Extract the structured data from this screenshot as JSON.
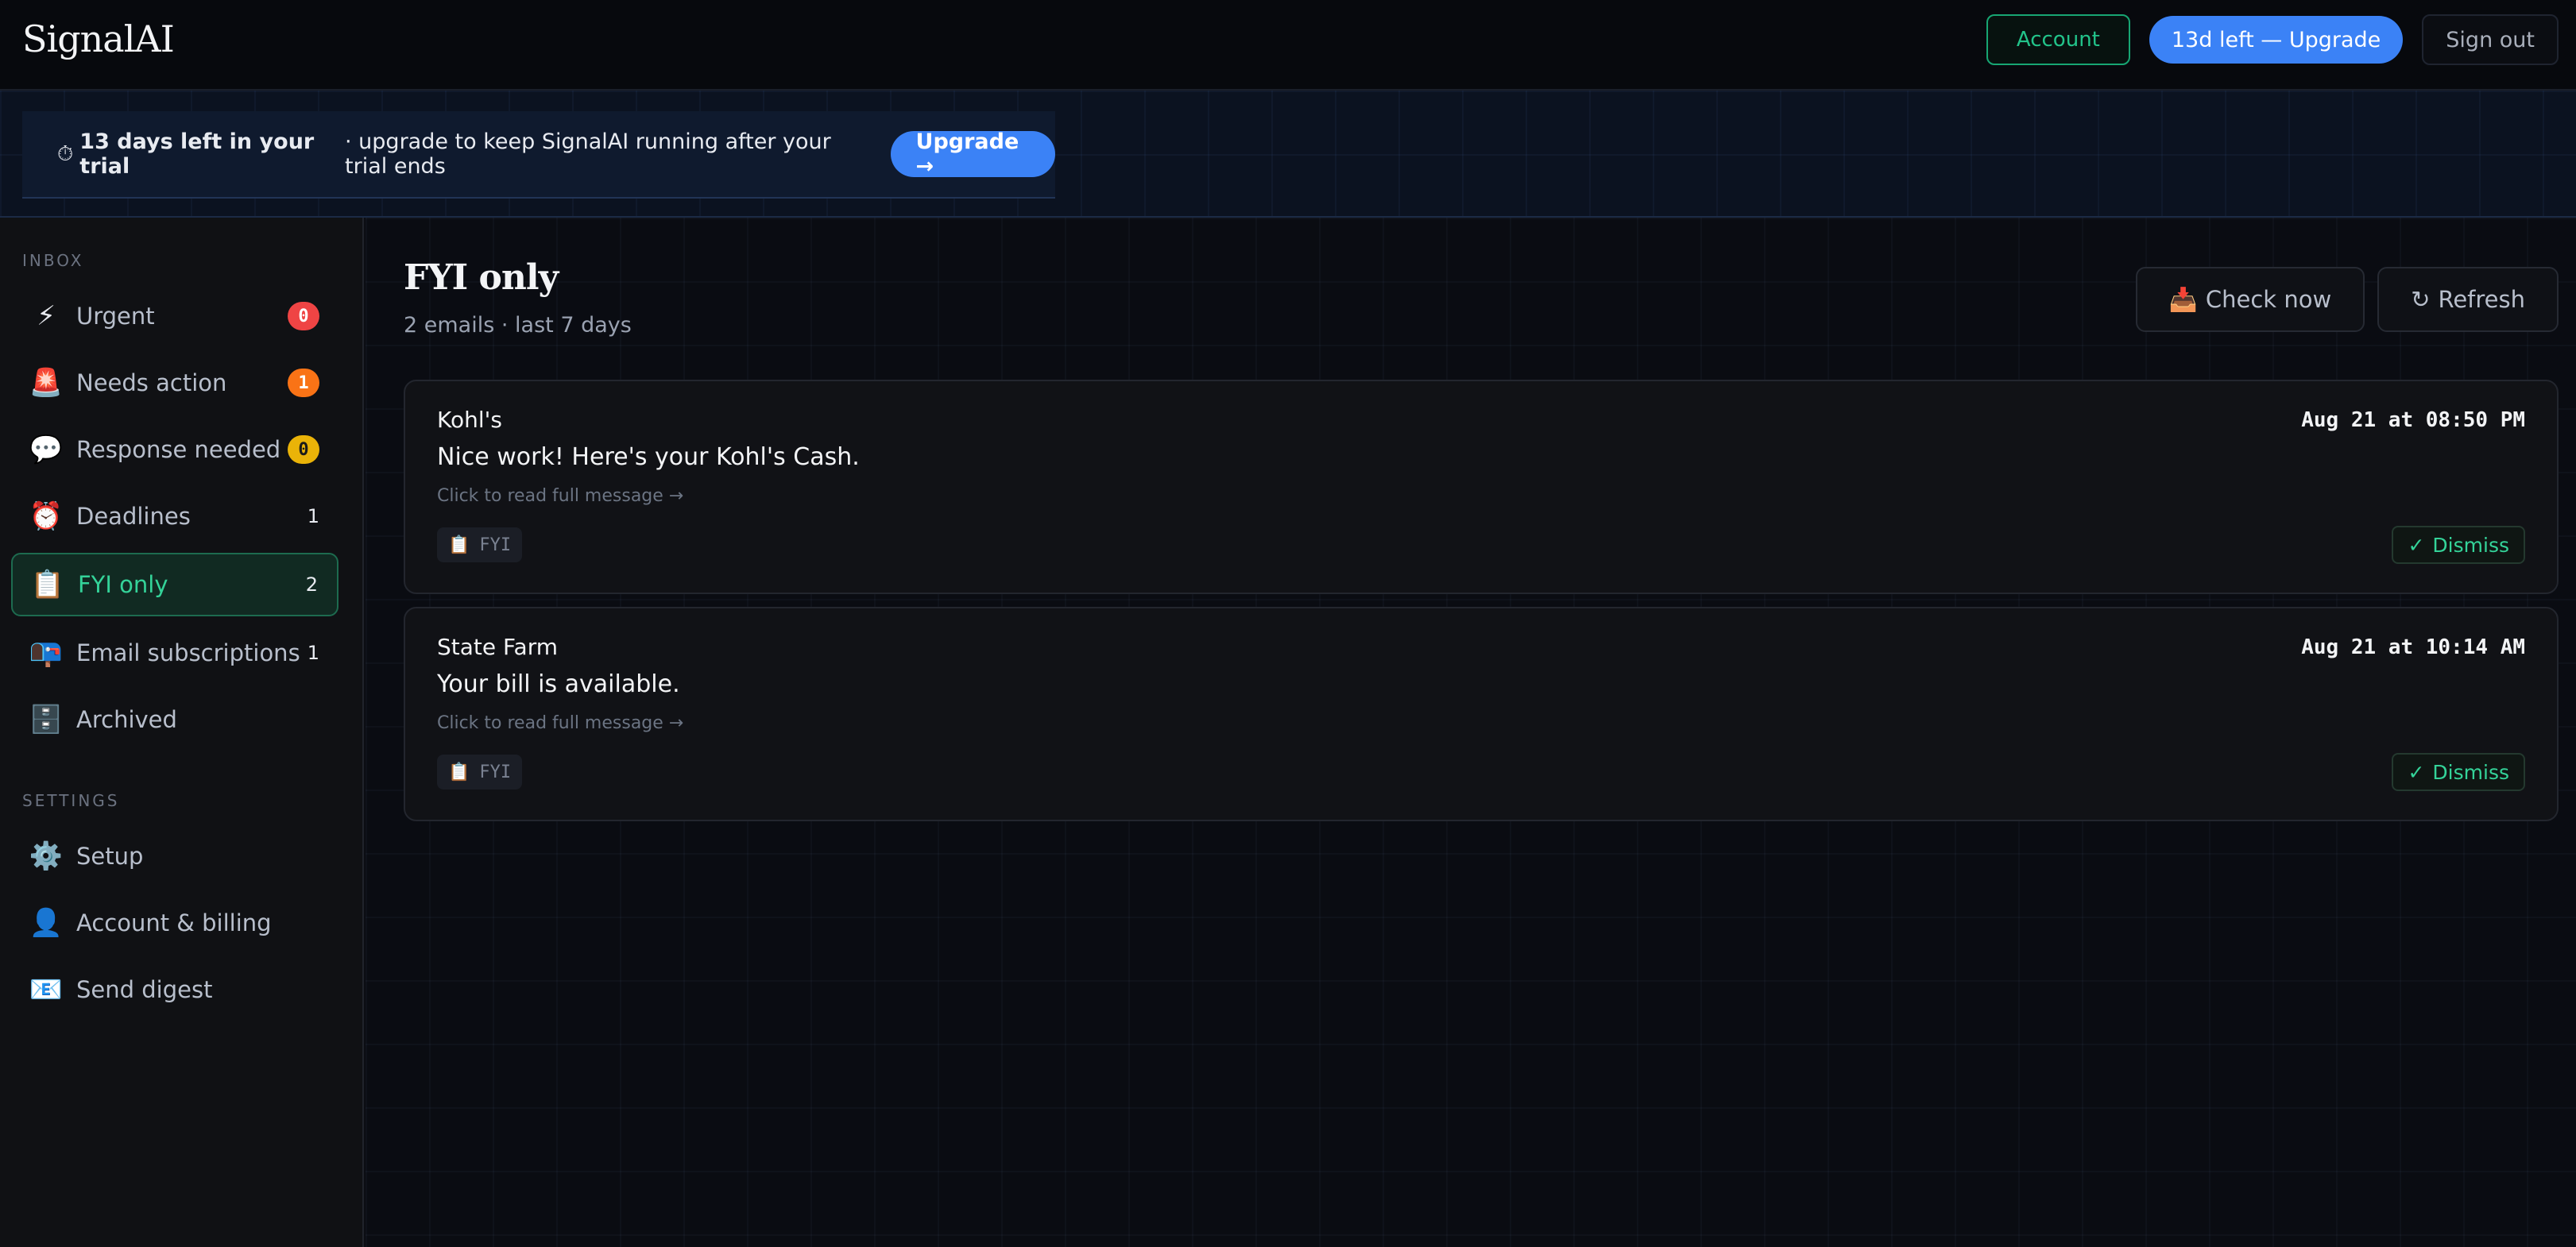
{
  "app": {
    "title": "SignalAI"
  },
  "topbar": {
    "account_label": "Account",
    "upgrade_label": "13d left — Upgrade",
    "signout_label": "Sign out"
  },
  "banner": {
    "icon": "⏱",
    "bold_text": "13 days left in your trial",
    "text": "· upgrade to keep SignalAI running after your trial ends",
    "button_label": "Upgrade →"
  },
  "sidebar": {
    "inbox_label": "INBOX",
    "settings_label": "SETTINGS",
    "inbox_items": [
      {
        "icon": "⚡",
        "label": "Urgent",
        "count": "0"
      },
      {
        "icon": "🚨",
        "label": "Needs action",
        "count": "1"
      },
      {
        "icon": "💬",
        "label": "Response needed",
        "count": "0"
      },
      {
        "icon": "⏰",
        "label": "Deadlines",
        "count": "1"
      },
      {
        "icon": "📋",
        "label": "FYI only",
        "count": "2"
      },
      {
        "icon": "📭",
        "label": "Email subscriptions",
        "count": "1"
      },
      {
        "icon": "🗄️",
        "label": "Archived"
      }
    ],
    "settings_items": [
      {
        "icon": "⚙️",
        "label": "Setup"
      },
      {
        "icon": "👤",
        "label": "Account & billing"
      },
      {
        "icon": "📧",
        "label": "Send digest"
      }
    ],
    "badge_colors": {
      "urgent": "#ef4444",
      "needs_action": "#f97316",
      "response_needed": "#eab308"
    }
  },
  "main": {
    "title": "FYI only",
    "subtitle": "2 emails · last 7 days",
    "check_now_icon": "📥",
    "check_now_label": "Check now",
    "refresh_icon": "↻",
    "refresh_label": "Refresh",
    "emails": [
      {
        "from": "Kohl's",
        "subject": "Nice work! Here's your Kohl's Cash.",
        "hint": "Click to read full message →",
        "date": "Aug 21 at 08:50 PM",
        "tag_icon": "📋",
        "tag": "FYI",
        "dismiss_icon": "✓",
        "dismiss_label": "Dismiss"
      },
      {
        "from": "State Farm",
        "subject": "Your bill is available.",
        "hint": "Click to read full message →",
        "date": "Aug 21 at 10:14 AM",
        "tag_icon": "📋",
        "tag": "FYI",
        "dismiss_icon": "✓",
        "dismiss_label": "Dismiss"
      }
    ]
  },
  "colors": {
    "accent": "#3b82f6",
    "active_green": "#34d399"
  }
}
